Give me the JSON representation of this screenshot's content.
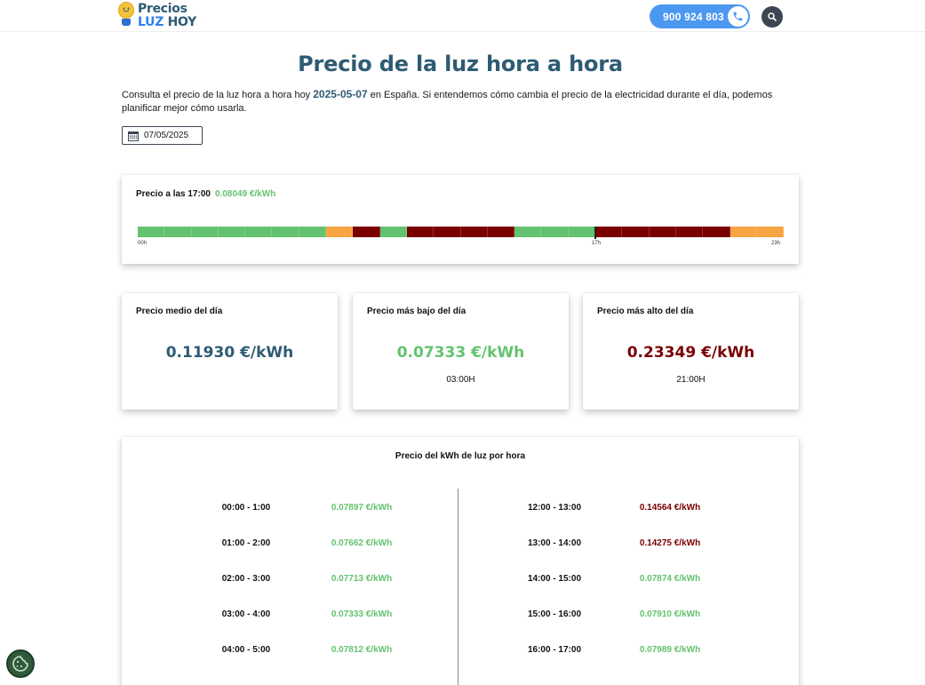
{
  "header": {
    "logo_line1": "Precios",
    "logo_line2_a": "LUZ",
    "logo_line2_b": "HOY",
    "phone": "900 924 803",
    "phone_icon": "phone-icon",
    "search_icon": "search-icon"
  },
  "page": {
    "title": "Precio de la luz hora a hora",
    "intro_before": "Consulta el precio de la luz hora a hora hoy ",
    "intro_date": "2025-05-07",
    "intro_after": " en España. Si entendemos cómo cambia el precio de la electricidad durante el día, podemos planificar mejor cómo usarla.",
    "date_value": "07/05/2025"
  },
  "now": {
    "label": "Precio a las 17:00",
    "value": "0.08049 €/kWh",
    "current_hour": 17,
    "tick_start": "00h",
    "tick_mid": "17h",
    "tick_end": "23h",
    "hour_levels": [
      "low",
      "low",
      "low",
      "low",
      "low",
      "low",
      "low",
      "mid",
      "high",
      "low",
      "high",
      "high",
      "high",
      "high",
      "low",
      "low",
      "low",
      "high",
      "high",
      "high",
      "high",
      "high",
      "mid",
      "mid"
    ]
  },
  "colors": {
    "low": "#63c26f",
    "mid": "#f7a543",
    "high": "#7a0000",
    "avg": "#2e5b74"
  },
  "stats": {
    "avg_label": "Precio medio del día",
    "avg_value": "0.11930 €/kWh",
    "low_label": "Precio más bajo del día",
    "low_value": "0.07333 €/kWh",
    "low_hour": "03:00H",
    "high_label": "Precio más alto del día",
    "high_value": "0.23349 €/kWh",
    "high_hour": "21:00H"
  },
  "table": {
    "title": "Precio del kWh de luz por hora",
    "left": [
      {
        "range": "00:00 - 1:00",
        "price": "0.07897 €/kWh",
        "level": "low"
      },
      {
        "range": "01:00 - 2:00",
        "price": "0.07662 €/kWh",
        "level": "low"
      },
      {
        "range": "02:00 - 3:00",
        "price": "0.07713 €/kWh",
        "level": "low"
      },
      {
        "range": "03:00 - 4:00",
        "price": "0.07333 €/kWh",
        "level": "low"
      },
      {
        "range": "04:00 - 5:00",
        "price": "0.07812 €/kWh",
        "level": "low"
      }
    ],
    "right": [
      {
        "range": "12:00 - 13:00",
        "price": "0.14564 €/kWh",
        "level": "high"
      },
      {
        "range": "13:00 - 14:00",
        "price": "0.14275 €/kWh",
        "level": "high"
      },
      {
        "range": "14:00 - 15:00",
        "price": "0.07874 €/kWh",
        "level": "low"
      },
      {
        "range": "15:00 - 16:00",
        "price": "0.07910 €/kWh",
        "level": "low"
      },
      {
        "range": "16:00 - 17:00",
        "price": "0.07989 €/kWh",
        "level": "low"
      }
    ]
  },
  "cookie_icon": "cookie-icon"
}
